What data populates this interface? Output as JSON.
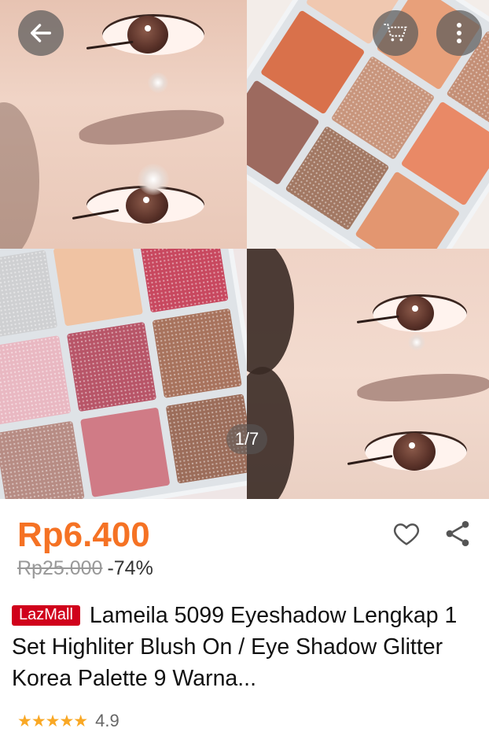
{
  "gallery": {
    "counter": "1/7",
    "buttons": {
      "back_icon": "arrow-left-icon",
      "cart_icon": "cart-icon",
      "more_icon": "more-vertical-icon"
    }
  },
  "product": {
    "price": "Rp6.400",
    "original_price": "Rp25.000",
    "discount": "-74%",
    "badge": "LazMall",
    "title": "Lameila 5099 Eyeshadow Lengkap 1 Set Highliter Blush On / Eye Shadow Glitter Korea Palette 9 Warna...",
    "rating": "4.9",
    "stars": "★★★★★"
  },
  "colors": {
    "price": "#f57224",
    "lazmall": "#d0011b",
    "stars": "#f9a825"
  }
}
